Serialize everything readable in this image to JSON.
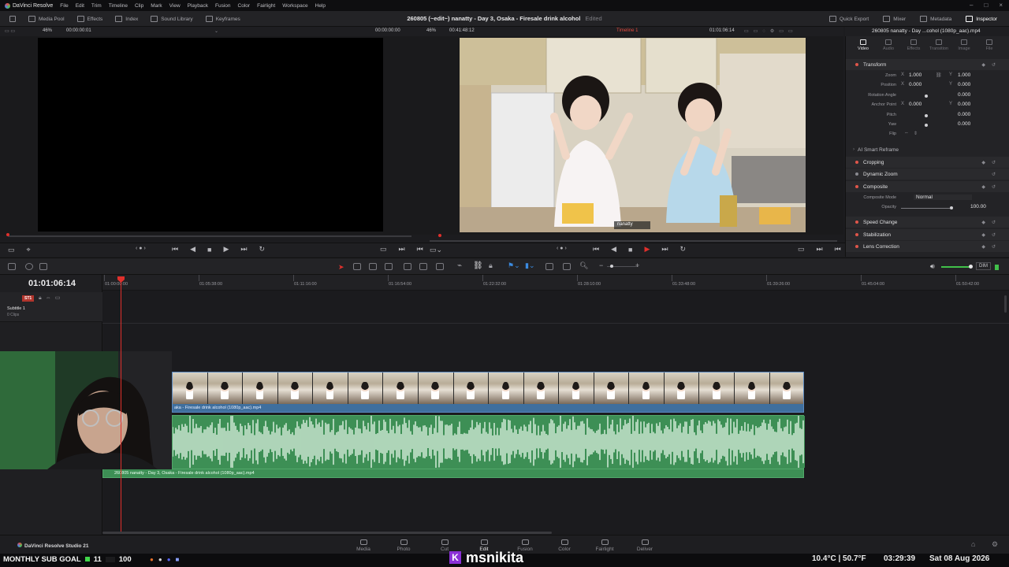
{
  "menubar": {
    "app_name": "DaVinci Resolve",
    "items": [
      "File",
      "Edit",
      "Trim",
      "Timeline",
      "Clip",
      "Mark",
      "View",
      "Playback",
      "Fusion",
      "Color",
      "Fairlight",
      "Workspace",
      "Help"
    ]
  },
  "toolbar": {
    "left": [
      "Media Pool",
      "Effects",
      "Index",
      "Sound Library",
      "Keyframes"
    ],
    "project_title": "260805  (~edit~) nanatty - Day 3, Osaka - Firesale drink alcohol",
    "edited_label": "Edited",
    "right": [
      "Quick Export",
      "Mixer",
      "Metadata",
      "Inspector"
    ]
  },
  "viewer_bar": {
    "source_zoom": "46%",
    "source_tc": "00:00:00:01",
    "tl_left_tc": "00:00:00:00",
    "tl_zoom": "46%",
    "tl_duration": "00:41:48:12",
    "timeline_name": "Timeline 1",
    "tl_current_tc": "01:01:06:14"
  },
  "inspector": {
    "clip_title": "260805  nanatty - Day ...cohol (1080p_aac).mp4",
    "tabs": [
      "Video",
      "Audio",
      "Effects",
      "Transition",
      "Image",
      "File"
    ],
    "sections": {
      "transform": "Transform",
      "ai_reframe": "AI Smart Reframe",
      "cropping": "Cropping",
      "dynamic_zoom": "Dynamic Zoom",
      "composite": "Composite",
      "speed_change": "Speed Change",
      "stabilization": "Stabilization",
      "lens_correction": "Lens Correction"
    },
    "props": {
      "zoom_label": "Zoom",
      "zoom_x": "1.000",
      "zoom_y": "1.000",
      "position_label": "Position",
      "position_x": "0.000",
      "position_y": "0.000",
      "rotation_label": "Rotation Angle",
      "rotation": "0.000",
      "anchor_label": "Anchor Point",
      "anchor_x": "0.000",
      "anchor_y": "0.000",
      "pitch_label": "Pitch",
      "pitch": "0.000",
      "yaw_label": "Yaw",
      "yaw": "0.000",
      "flip_label": "Flip",
      "composite_mode_label": "Composite Mode",
      "composite_mode": "Normal",
      "opacity_label": "Opacity",
      "opacity": "100.00"
    },
    "axis_x": "X",
    "axis_y": "Y"
  },
  "timeline": {
    "current_tc": "01:01:06:14",
    "ruler": [
      "01:00:00:00",
      "01:05:38:00",
      "01:11:16:00",
      "01:16:54:00",
      "01:22:32:00",
      "01:28:10:00",
      "01:33:48:00",
      "01:39:26:00",
      "01:45:04:00",
      "01:50:42:00"
    ],
    "subtitle_track": {
      "badge": "ST1",
      "name": "Subtitle 1",
      "clips": "0 Clips"
    },
    "video_clip_name": "aka - Firesale drink alcohol (1080p_aac).mp4",
    "audio_clip_name": "260805  nanatty - Day 3, Osaka - Firesale drink alcohol (1080p_aac).mp4",
    "dim_label": "DIM"
  },
  "viewer_overlay": {
    "watermark": "nanatty"
  },
  "pages": {
    "brand": "DaVinci Resolve Studio 21",
    "tabs": [
      "Media",
      "Photo",
      "Cut",
      "Edit",
      "Fusion",
      "Color",
      "Fairlight",
      "Deliver"
    ],
    "active": "Edit"
  },
  "stream_overlay": {
    "sub_goal_label": "MONTHLY SUB GOAL",
    "sub_current": "11",
    "sub_target": "100",
    "channel": "msnikita",
    "channel_icon": "K",
    "weather": "10.4°C | 50.7°F",
    "time": "03:29:39",
    "date": "Sat 08 Aug 2026"
  },
  "colors": {
    "accent_red": "#e0302c",
    "video_clip": "#3f6f9e",
    "audio_clip": "#3d8f55",
    "brand_purple": "#8b2fd6"
  }
}
